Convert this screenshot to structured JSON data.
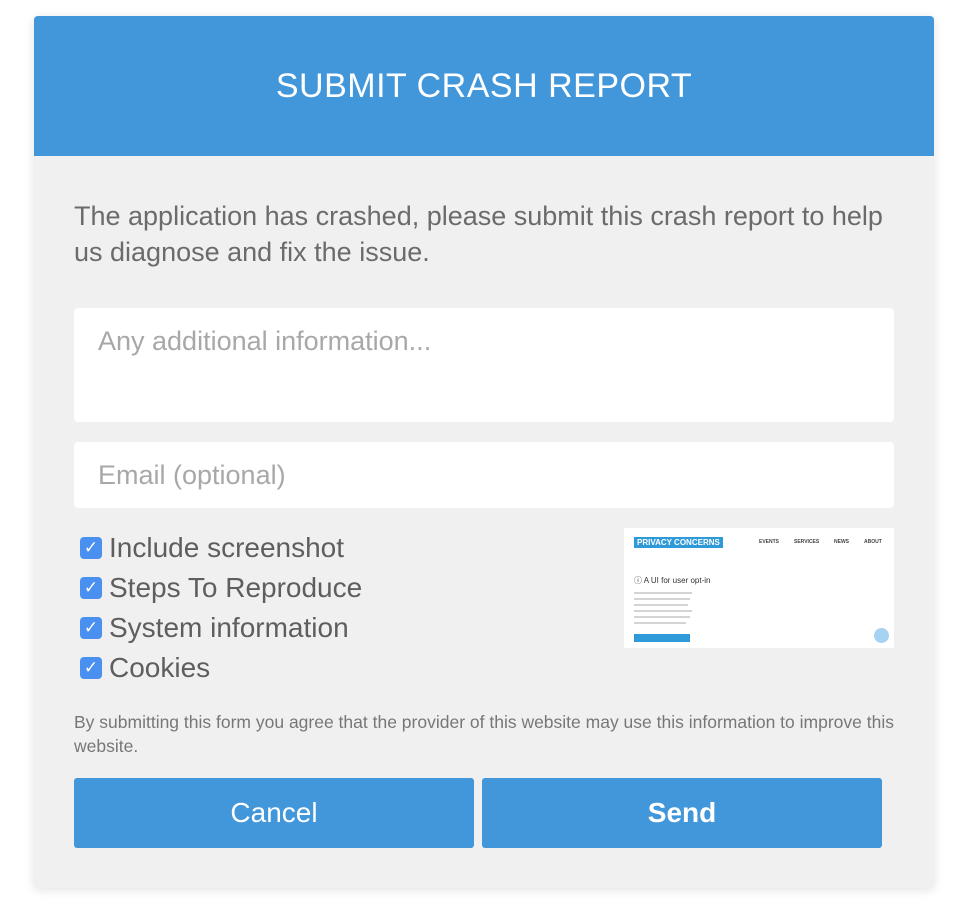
{
  "dialog": {
    "title": "SUBMIT CRASH REPORT",
    "message": "The application has crashed, please submit this crash report to help us diagnose and fix the issue.",
    "additional_info": {
      "value": "",
      "placeholder": "Any additional information..."
    },
    "email": {
      "value": "",
      "placeholder": "Email (optional)"
    },
    "checkboxes": [
      {
        "label": "Include screenshot",
        "checked": true
      },
      {
        "label": "Steps To Reproduce",
        "checked": true
      },
      {
        "label": "System information",
        "checked": true
      },
      {
        "label": "Cookies",
        "checked": true
      }
    ],
    "screenshot_preview": {
      "brand": "PRIVACY CONCERNS",
      "nav": [
        "EVENTS",
        "SERVICES",
        "NEWS",
        "ABOUT"
      ],
      "heading": "A UI for user opt-in"
    },
    "consent_text": "By submitting this form you agree that the provider of this website may use this information to improve this website.",
    "cancel_label": "Cancel",
    "send_label": "Send"
  },
  "colors": {
    "accent": "#4297db",
    "checkbox": "#4a90f0",
    "background": "#f0f0f0"
  }
}
